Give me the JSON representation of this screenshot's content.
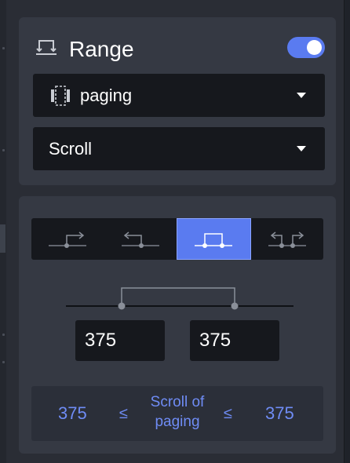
{
  "range": {
    "title": "Range",
    "enabled": true,
    "element_select": {
      "value": "paging",
      "icon": "paging-element-icon"
    },
    "event_select": {
      "value": "Scroll"
    }
  },
  "mode": {
    "options": [
      {
        "id": "forward",
        "icon": "range-forward-icon",
        "active": false
      },
      {
        "id": "backward",
        "icon": "range-backward-icon",
        "active": false
      },
      {
        "id": "between",
        "icon": "range-between-icon",
        "active": true
      },
      {
        "id": "outside",
        "icon": "range-outside-icon",
        "active": false
      }
    ],
    "from_value": "375",
    "to_value": "375"
  },
  "summary": {
    "from": "375",
    "le_left": "≤",
    "middle_line1": "Scroll of",
    "middle_line2": "paging",
    "le_right": "≤",
    "to": "375"
  },
  "colors": {
    "accent": "#5a7bf0",
    "summary_text": "#6f8cf5",
    "card": "#353943",
    "field": "#16181d"
  }
}
